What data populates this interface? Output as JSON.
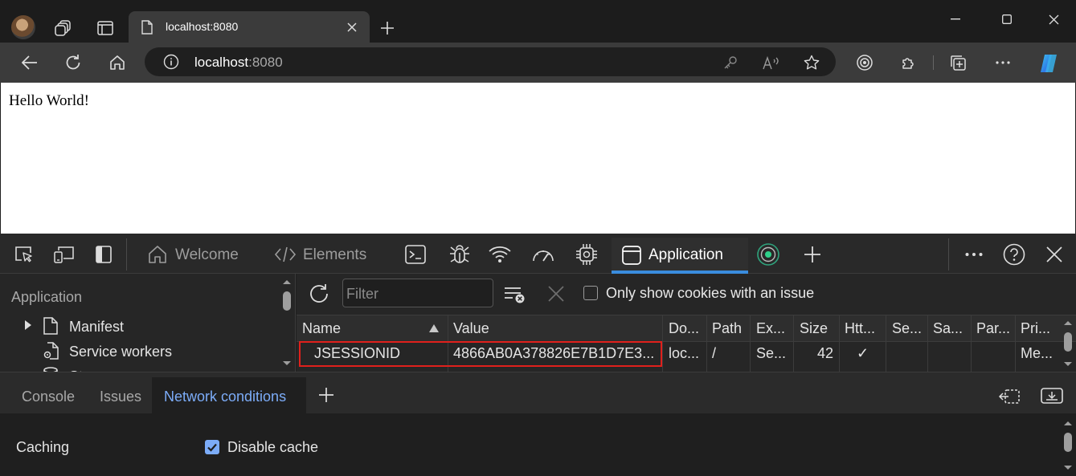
{
  "browser": {
    "tab_title": "localhost:8080",
    "url_host": "localhost",
    "url_port": ":8080"
  },
  "page": {
    "body_text": "Hello World!"
  },
  "devtools": {
    "tabs": {
      "welcome": "Welcome",
      "elements": "Elements",
      "application": "Application"
    },
    "sidebar": {
      "heading": "Application",
      "items": [
        {
          "label": "Manifest",
          "icon": "file-icon"
        },
        {
          "label": "Service workers",
          "icon": "gear-file-icon"
        },
        {
          "label": "St",
          "icon": "database-icon"
        }
      ]
    },
    "cookies": {
      "filter_placeholder": "Filter",
      "only_issues_label": "Only show cookies with an issue",
      "only_issues_checked": false,
      "columns": [
        "Name",
        "Value",
        "Do...",
        "Path",
        "Ex...",
        "Size",
        "Htt...",
        "Se...",
        "Sa...",
        "Par...",
        "Pri..."
      ],
      "rows": [
        {
          "name": "JSESSIONID",
          "value": "4866AB0A378826E7B1D7E3...",
          "domain": "loc...",
          "path": "/",
          "expires": "Se...",
          "size": "42",
          "http_only": "✓",
          "secure": "",
          "samesite": "",
          "partition": "",
          "priority": "Me..."
        }
      ],
      "highlight_color": "#e0201c"
    },
    "drawer": {
      "tabs": [
        "Console",
        "Issues",
        "Network conditions"
      ],
      "active_tab": "Network conditions",
      "caching_label": "Caching",
      "disable_cache_label": "Disable cache",
      "disable_cache_checked": true
    }
  },
  "colors": {
    "accent": "#3a8dde",
    "checkbox_on": "#7cacf8"
  }
}
